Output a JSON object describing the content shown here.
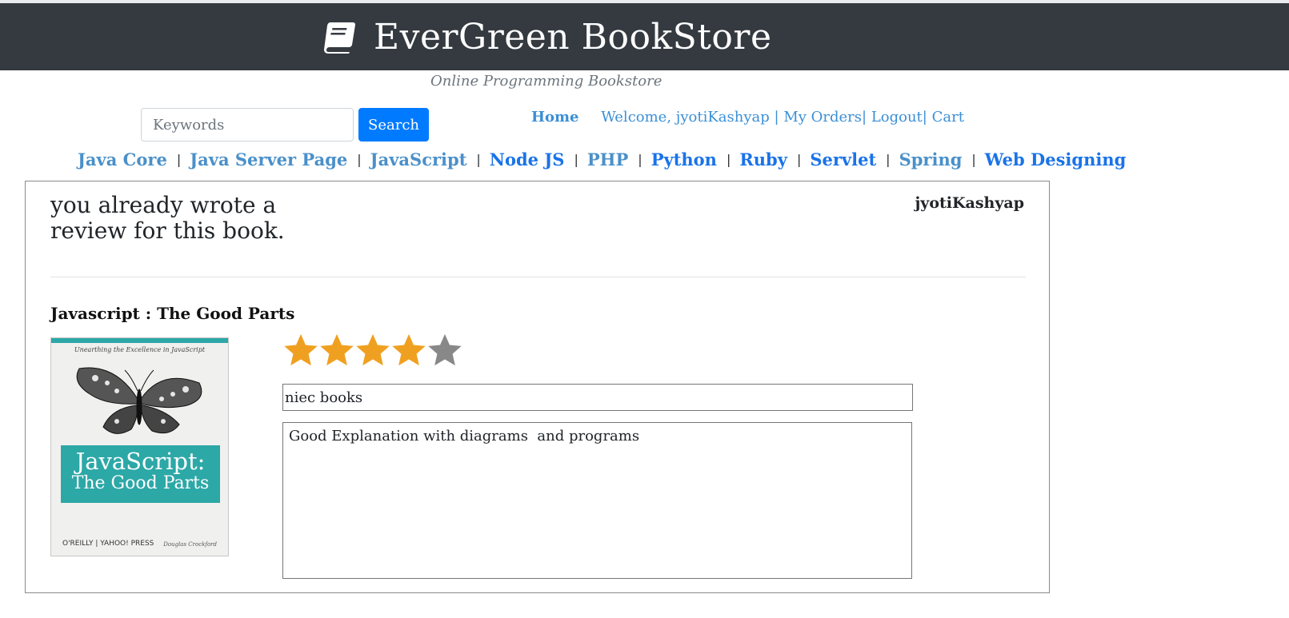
{
  "header": {
    "title": "EverGreen BookStore",
    "tagline": "Online Programming Bookstore",
    "icon": "book-icon",
    "background": "#343a40"
  },
  "search": {
    "placeholder": "Keywords",
    "value": "",
    "button_label": "Search",
    "button_color": "#007bff"
  },
  "user_nav": {
    "home_label": "Home",
    "welcome_text": "Welcome, jyotiKashyap",
    "my_orders_label": "My Orders",
    "logout_label": "Logout",
    "cart_label": "Cart",
    "sep1": " | ",
    "sep2": "| ",
    "sep3": "| "
  },
  "categories": [
    {
      "label": "Java Core"
    },
    {
      "label": "Java Server Page"
    },
    {
      "label": "JavaScript"
    },
    {
      "label": "Node JS"
    },
    {
      "label": "PHP"
    },
    {
      "label": "Python"
    },
    {
      "label": "Ruby"
    },
    {
      "label": "Servlet"
    },
    {
      "label": "Spring"
    },
    {
      "label": "Web Designing"
    }
  ],
  "category_separator": "|",
  "review": {
    "message": "you already wrote a review for this book.",
    "username": "jyotiKashyap",
    "book_title": "Javascript : The Good Parts",
    "rating": 4,
    "max_rating": 5,
    "star_filled_color": "#f0a020",
    "star_empty_color": "#888888",
    "headline": "niec books",
    "comment": "Good Explanation with diagrams  and programs"
  },
  "cover": {
    "subtitle": "Unearthing the Excellence in JavaScript",
    "title_line1": "JavaScript:",
    "title_line2": "The Good Parts",
    "publisher": "O'REILLY  |  YAHOO! PRESS",
    "author": "Douglas Crockford",
    "accent": "#2ca8a7"
  }
}
